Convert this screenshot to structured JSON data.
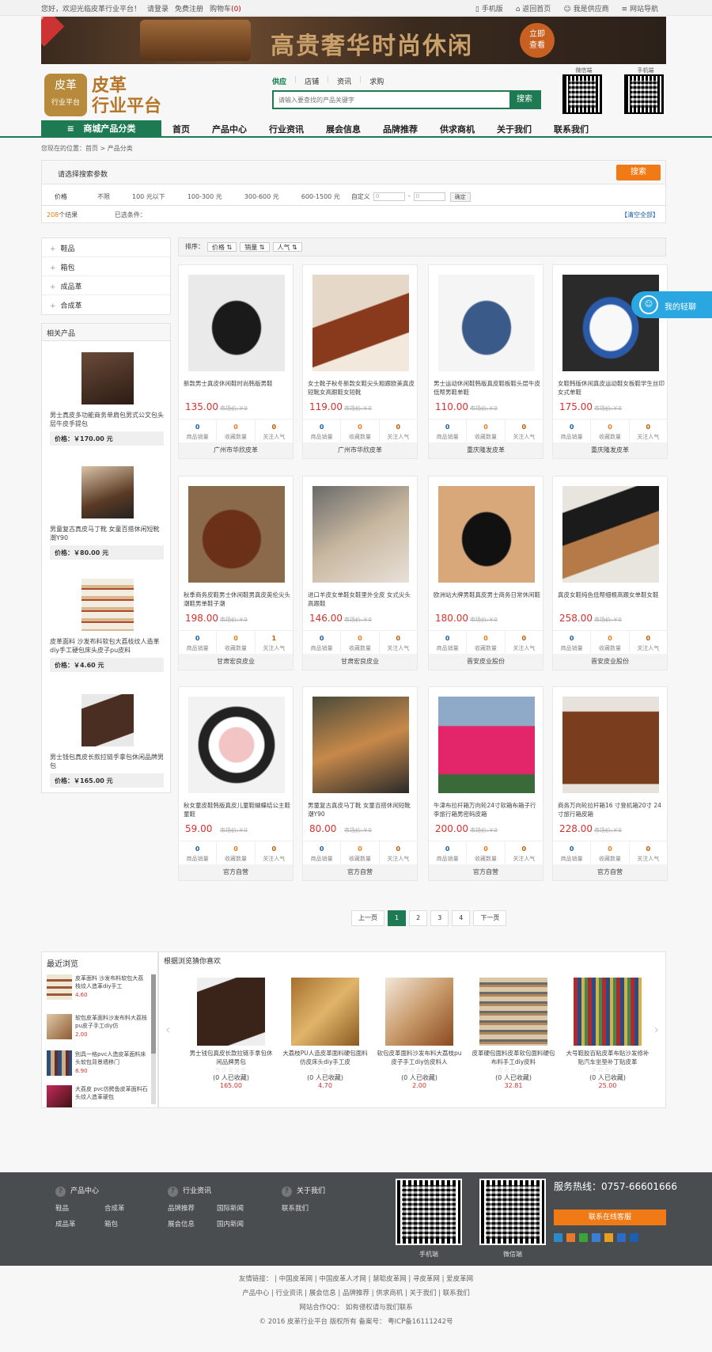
{
  "topbar": {
    "welcome": "您好，欢迎光临皮革行业平台！",
    "login": "请登录",
    "register": "免费注册",
    "cart": "购物车",
    "cart_count": "(0)",
    "mobile": "手机版",
    "home": "返回首页",
    "supplier": "我是供应商",
    "sitemap": "网站导航"
  },
  "banner": {
    "title": "高贵奢华时尚休闲",
    "badge": "品牌直销",
    "btn_line1": "立即",
    "btn_line2": "查看"
  },
  "logo": {
    "box1": "皮革",
    "box2": "行业平台",
    "txt1": "皮革",
    "txt2": "行业平台"
  },
  "search": {
    "tabs": [
      "供应",
      "店铺",
      "资讯",
      "求购"
    ],
    "placeholder": "请输入要查找的产品关键字",
    "button": "搜索"
  },
  "qr": {
    "weixin": "微信端",
    "mobile": "手机端"
  },
  "nav": {
    "category": "商城产品分类",
    "items": [
      "首页",
      "产品中心",
      "行业资讯",
      "展会信息",
      "品牌推荐",
      "供求商机",
      "关于我们",
      "联系我们"
    ]
  },
  "breadcrumb": {
    "text": "您现在的位置：首页 > 产品分类"
  },
  "filter": {
    "title": "请选择搜索参数",
    "search_btn": "搜索",
    "price_label": "价格",
    "options": [
      "不限",
      "100 元以下",
      "100-300 元",
      "300-600 元",
      "600-1500 元"
    ],
    "custom": "自定义",
    "from": "0",
    "dash": "-",
    "to": "0",
    "ok": "确定",
    "count": "208",
    "count_suffix": "个结果",
    "selected": "已选条件：",
    "clear": "【清空全部】"
  },
  "categories": [
    "鞋品",
    "箱包",
    "成品革",
    "合成革"
  ],
  "related": {
    "title": "相关产品",
    "items": [
      {
        "name": "男士真皮多功能商务单肩包男式公文包头层牛皮手提包",
        "price": "价格：￥170.00 元"
      },
      {
        "name": "男童复古真皮马丁靴 女童百搭休闲短靴潮Y90",
        "price": "价格：￥80.00 元"
      },
      {
        "name": "皮革面料 沙发布料软包大荔枝纹人造革diy手工硬包床头皮子pu皮料",
        "price": "价格：￥4.60 元"
      },
      {
        "name": "男士钱包真皮长款拉链手拿包休闲品牌男包",
        "price": "价格：￥165.00 元"
      }
    ]
  },
  "sort": {
    "label": "排序：",
    "b1": "价格",
    "b2": "销量",
    "b3": "人气"
  },
  "chat": {
    "label": "我的轻聊"
  },
  "stat_labels": [
    "商品销量",
    "收藏数量",
    "关注人气"
  ],
  "market_price": "市场价:￥0",
  "products": [
    {
      "name": "新款男士真皮休闲鞋时尚韩版男鞋",
      "price": "135.00",
      "s": [
        "0",
        "0",
        "0"
      ],
      "shop": "广州市华欣皮革"
    },
    {
      "name": "女士靴子秋冬新款女鞋尖头粗跟欧美真皮短靴女高跟鞋女短靴",
      "price": "119.00",
      "s": [
        "0",
        "0",
        "0"
      ],
      "shop": "广州市华欣皮革"
    },
    {
      "name": "男士运动休闲鞋韩版真皮鞋板鞋头层牛皮低帮男鞋单鞋",
      "price": "110.00",
      "s": [
        "0",
        "0",
        "0"
      ],
      "shop": "重庆隆发皮革"
    },
    {
      "name": "女鞋韩版休闲真皮运动鞋女板鞋学生丝印女式单鞋",
      "price": "175.00",
      "s": [
        "0",
        "0",
        "0"
      ],
      "shop": "重庆隆发皮革"
    },
    {
      "name": "秋季商务皮鞋男士休闲鞋男真皮英伦尖头潮鞋男单鞋子潮",
      "price": "198.00",
      "s": [
        "0",
        "0",
        "1"
      ],
      "shop": "甘肃宏良皮业"
    },
    {
      "name": "进口羊皮女单鞋女鞋里外全皮 女式尖头高跟鞋",
      "price": "146.00",
      "s": [
        "0",
        "0",
        "0"
      ],
      "shop": "甘肃宏良皮业"
    },
    {
      "name": "欧洲站大牌男鞋真皮男士商务日常休闲鞋",
      "price": "180.00",
      "s": [
        "0",
        "0",
        "0"
      ],
      "shop": "晋安皮业股份"
    },
    {
      "name": "真皮女鞋纯色低帮细根高跟女单鞋女鞋",
      "price": "258.00",
      "s": [
        "0",
        "0",
        "0"
      ],
      "shop": "晋安皮业股份"
    },
    {
      "name": "秋女童皮鞋韩版真皮儿童鞋蝴蝶结公主鞋童鞋",
      "price": "59.00",
      "s": [
        "0",
        "0",
        "0"
      ],
      "shop": "官方自营"
    },
    {
      "name": "男童复古真皮马丁靴 女童百搭休闲短靴潮Y90",
      "price": "80.00",
      "s": [
        "0",
        "0",
        "0"
      ],
      "shop": "官方自营"
    },
    {
      "name": "牛津布拉杆箱万向轮24寸软箱布箱子行李旅行箱男密码皮箱",
      "price": "200.00",
      "s": [
        "0",
        "0",
        "0"
      ],
      "shop": "官方自营"
    },
    {
      "name": "商务万向轮拉杆箱16 寸登机箱20寸 24寸旅行箱皮箱",
      "price": "228.00",
      "s": [
        "0",
        "0",
        "0"
      ],
      "shop": "官方自营"
    }
  ],
  "pager": {
    "prev": "上一页",
    "pages": [
      "1",
      "2",
      "3",
      "4"
    ],
    "next": "下一页"
  },
  "recent": {
    "title": "最近浏览",
    "items": [
      {
        "name": "皮革面料 沙发布料软包大荔枝纹人造革diy手工",
        "price": "4.60"
      },
      {
        "name": "软包皮革面料沙发布料大荔枝pu皮子手工diy仿",
        "price": "2.00"
      },
      {
        "name": "别具一格pvc人造皮革面料床头软包背景墙移门",
        "price": "8.90"
      },
      {
        "name": "大荔皮 pvc仿鳄鱼皮革面料石头纹人造革硬包",
        "price": ""
      }
    ]
  },
  "guess": {
    "title": "根据浏览猜你喜欢",
    "stars": "☆☆☆☆☆",
    "items": [
      {
        "name": "男士钱包真皮长款拉链手拿包休闲品牌男包",
        "count": "(0 人已收藏)",
        "price": "165.00"
      },
      {
        "name": "大荔枝PU人造皮革面料硬包面料仿皮床头diy手工皮",
        "count": "(0 人已收藏)",
        "price": "4.70"
      },
      {
        "name": "软包皮革面料沙发布料大荔枝pu皮子手工diy仿皮料人",
        "count": "(0 人已收藏)",
        "price": "2.00"
      },
      {
        "name": "皮革硬包面料皮革软包面料硬包布料手工diy皮料",
        "count": "(0 人已收藏)",
        "price": "32.81"
      },
      {
        "name": "大号鞋胶百粘皮革布贴沙发修补贴汽车坐垫补丁贴皮革",
        "count": "(0 人已收藏)",
        "price": "25.00"
      }
    ]
  },
  "footer": {
    "col1": {
      "title": "产品中心",
      "links": [
        "鞋品",
        "合成革",
        "成品革",
        "箱包"
      ]
    },
    "col2": {
      "title": "行业资讯",
      "links": [
        "品牌推荐",
        "国际新闻",
        "展会信息",
        "国内新闻"
      ]
    },
    "col3": {
      "title": "关于我们",
      "links": [
        "联系我们"
      ]
    },
    "qr1": "手机端",
    "qr2": "微信端",
    "hotline": "服务热线：0757-66601666",
    "kefu": "联系在线客服"
  },
  "links": {
    "friend": "友情链接：  |  中国皮革网  |  中国皮革人才网  |  慧聪皮革网  |  寻皮革网  |  爱皮革网",
    "nav": "产品中心  |  行业资讯  |  展会信息  |  品牌推荐  |  供求商机  |  关于我们  |  联系我们",
    "qq": "网站合作QQ：       如有侵权请与我们联系",
    "copy": "© 2016 皮革行业平台 版权所有   备案号： 粤ICP备16111242号"
  },
  "colors": {
    "primary": "#1d7a52",
    "orange": "#f07b16",
    "price": "#d0332e",
    "chat": "#2aa6e0"
  }
}
